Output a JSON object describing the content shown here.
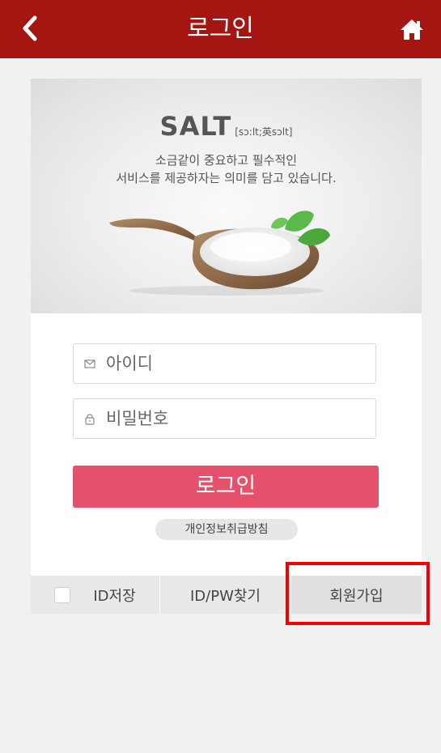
{
  "header": {
    "title": "로그인",
    "back_icon": "chevron-left-icon",
    "home_icon": "home-icon",
    "bg_color": "#a51612"
  },
  "hero": {
    "brand": "SALT",
    "pronunciation": "[sɔ:lt;英sɔlt]",
    "tagline_line1": "소금같이 중요하고 필수적인",
    "tagline_line2": "서비스를 제공하자는 의미를 담고 있습니다."
  },
  "form": {
    "id_placeholder": "아이디",
    "password_placeholder": "비밀번호",
    "login_label": "로그인",
    "privacy_label": "개인정보취급방침",
    "login_color": "#e5516a"
  },
  "footer": {
    "save_id_label": "ID저장",
    "find_label": "ID/PW찾기",
    "signup_label": "회원가입"
  }
}
